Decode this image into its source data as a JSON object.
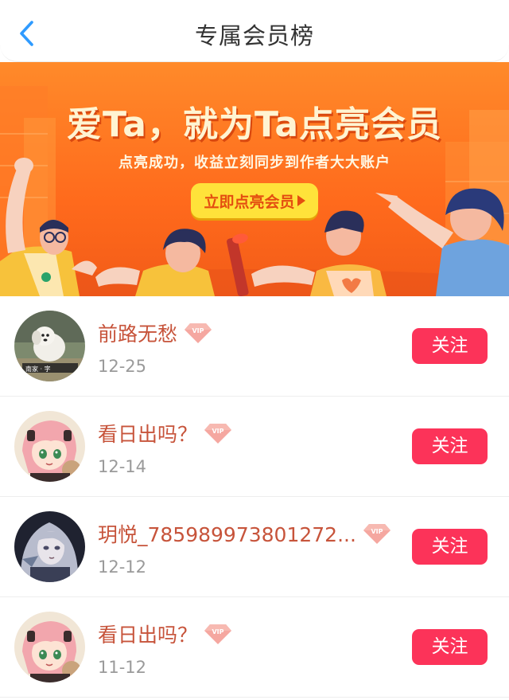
{
  "header": {
    "title": "专属会员榜",
    "back_icon": "chevron-left-icon",
    "accent_color": "#2f9bff"
  },
  "banner": {
    "headline": "爱Ta，就为Ta点亮会员",
    "subline": "点亮成功，收益立刻同步到作者大大账户",
    "cta_label": "立即点亮会员",
    "colors": {
      "background": "#ff6a1c",
      "cta": "#ffe23a"
    }
  },
  "members": [
    {
      "name": "前路无愁",
      "date": "12-25",
      "follow_label": "关注",
      "avatar": "dog-photo-avatar",
      "badge": "VIP"
    },
    {
      "name": "看日出吗？",
      "date": "12-14",
      "follow_label": "关注",
      "avatar": "anime-girl-pink-hair-avatar",
      "badge": "VIP"
    },
    {
      "name": "玥悦_785989973801272...",
      "date": "12-12",
      "follow_label": "关注",
      "avatar": "dark-anime-girl-avatar",
      "badge": "VIP"
    },
    {
      "name": "看日出吗？",
      "date": "11-12",
      "follow_label": "关注",
      "avatar": "anime-girl-pink-hair-avatar",
      "badge": "VIP"
    }
  ],
  "colors": {
    "follow_button": "#fc3359",
    "username_text": "#c7543b",
    "date_text": "#9a9a9a"
  }
}
